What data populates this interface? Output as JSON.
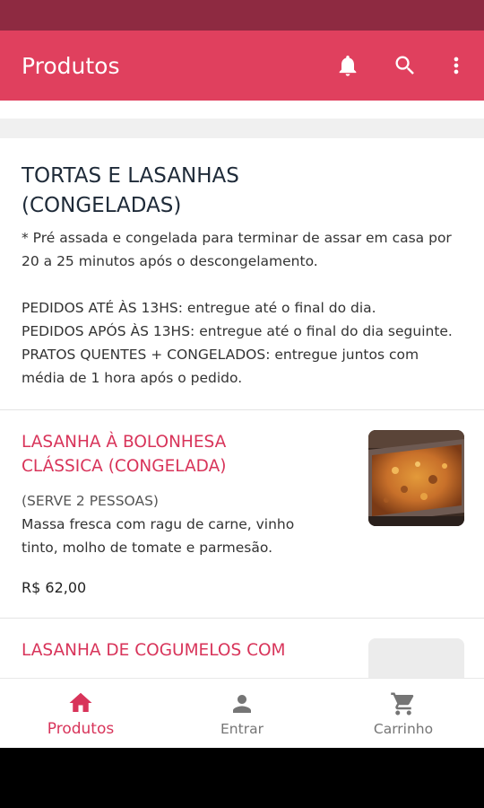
{
  "app_bar": {
    "title": "Produtos",
    "actions": [
      {
        "icon": "bell-icon"
      },
      {
        "icon": "search-icon"
      },
      {
        "icon": "more-vert-icon"
      }
    ]
  },
  "section": {
    "title": "TORTAS E LASANHAS\n(CONGELADAS)",
    "description": "* Pré assada e congelada para terminar de assar em casa por 20 a 25 minutos após o descongelamento.\n\nPEDIDOS ATÉ ÀS 13HS: entregue até o final do dia.\nPEDIDOS  APÓS ÀS 13HS: entregue até o final do dia seguinte.\nPRATOS QUENTES + CONGELADOS: entregue juntos com média de 1 hora após o pedido."
  },
  "products": [
    {
      "name": "LASANHA À BOLONHESA\nCLÁSSICA (CONGELADA)",
      "serves": "(SERVE 2 PESSOAS)",
      "description": "Massa fresca com ragu de carne, vinho\ntinto, molho de tomate e parmesão.",
      "price": "R$ 62,00"
    },
    {
      "name": "LASANHA  DE COGUMELOS COM",
      "serves": "",
      "description": "",
      "price": ""
    }
  ],
  "bottom_nav": {
    "items": [
      {
        "label": "Produtos",
        "icon": "home-icon",
        "active": true
      },
      {
        "label": "Entrar",
        "icon": "person-icon",
        "active": false
      },
      {
        "label": "Carrinho",
        "icon": "cart-icon",
        "active": false
      }
    ]
  },
  "colors": {
    "status_bar": "#8e2a41",
    "app_bar": "#e0405e",
    "accent": "#d8345a"
  }
}
